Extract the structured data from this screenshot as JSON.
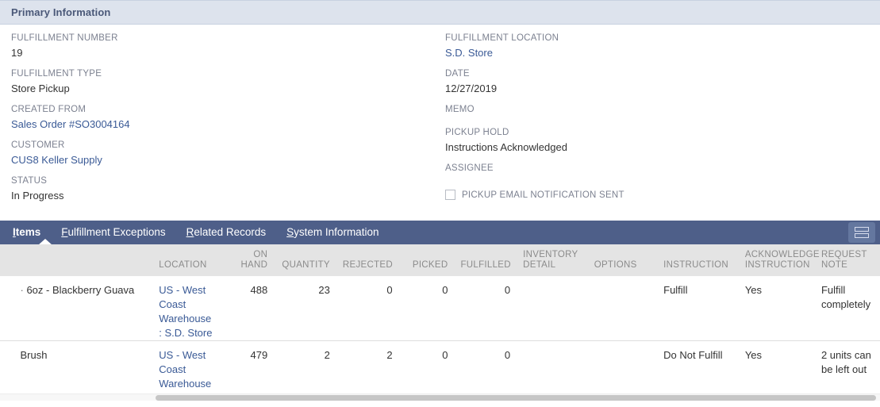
{
  "section": {
    "title": "Primary Information"
  },
  "primary": {
    "left_fields": [
      {
        "label": "FULFILLMENT NUMBER",
        "value": "19",
        "link": false
      },
      {
        "label": "FULFILLMENT TYPE",
        "value": "Store Pickup",
        "link": false
      },
      {
        "label": "CREATED FROM",
        "value": "Sales Order #SO3004164",
        "link": true
      },
      {
        "label": "CUSTOMER",
        "value": "CUS8 Keller Supply",
        "link": true
      },
      {
        "label": "STATUS",
        "value": "In Progress",
        "link": false
      }
    ],
    "right_fields": [
      {
        "label": "FULFILLMENT LOCATION",
        "value": "S.D. Store",
        "link": true
      },
      {
        "label": "DATE",
        "value": "12/27/2019",
        "link": false
      },
      {
        "label": "MEMO",
        "value": "",
        "link": false
      },
      {
        "label": "PICKUP HOLD",
        "value": "Instructions Acknowledged",
        "link": false
      },
      {
        "label": "ASSIGNEE",
        "value": "",
        "link": false
      }
    ],
    "checkbox": {
      "label": "PICKUP EMAIL NOTIFICATION SENT",
      "checked": false
    }
  },
  "tabs": [
    {
      "label": "Items",
      "accel": "I",
      "rest": "tems",
      "active": true
    },
    {
      "label": "Fulfillment Exceptions",
      "accel": "F",
      "rest": "ulfillment Exceptions",
      "active": false
    },
    {
      "label": "Related Records",
      "accel": "R",
      "rest": "elated Records",
      "active": false
    },
    {
      "label": "System Information",
      "accel": "S",
      "rest": "ystem Information",
      "active": false
    }
  ],
  "tab_menu_icon": "list-view-icon",
  "table": {
    "columns": [
      "LOCATION",
      "ON HAND",
      "QUANTITY",
      "REJECTED",
      "PICKED",
      "FULFILLED",
      "INVENTORY DETAIL",
      "OPTIONS",
      "INSTRUCTION",
      "ACKNOWLEDGE INSTRUCTION",
      "REQUEST NOTE"
    ],
    "columns_split": {
      "location": "LOCATION",
      "on_hand_l1": "ON",
      "on_hand_l2": "HAND",
      "quantity": "QUANTITY",
      "rejected": "REJECTED",
      "picked": "PICKED",
      "fulfilled": "FULFILLED",
      "inventory_l1": "INVENTORY",
      "inventory_l2": "DETAIL",
      "options": "OPTIONS",
      "instruction": "INSTRUCTION",
      "acknowledge_l1": "ACKNOWLEDGE",
      "acknowledge_l2": "INSTRUCTION",
      "request_l1": "REQUEST",
      "request_l2": "NOTE"
    },
    "rows": [
      {
        "item_prefix": "·",
        "item": "6oz - Blackberry Guava",
        "location": "US - West Coast Warehouse : S.D. Store",
        "on_hand": "488",
        "quantity": "23",
        "rejected": "0",
        "picked": "0",
        "fulfilled": "0",
        "inventory_detail": "",
        "options": "",
        "instruction": "Fulfill",
        "acknowledge_instruction": "Yes",
        "request_note": "Fulfill completely"
      },
      {
        "item_prefix": "",
        "item": "Brush",
        "location": "US - West Coast Warehouse : S.D. Store",
        "on_hand": "479",
        "quantity": "2",
        "rejected": "2",
        "picked": "0",
        "fulfilled": "0",
        "inventory_detail": "",
        "options": "",
        "instruction": "Do Not Fulfill",
        "acknowledge_instruction": "Yes",
        "request_note": "2 units can be left out"
      }
    ]
  },
  "colors": {
    "header_bg": "#dde3ed",
    "header_text": "#4a5878",
    "tabbar_bg": "#4e5f89",
    "link": "#3a5a96",
    "table_header_bg": "#e4e4e4",
    "table_header_text": "#8b8b8b"
  }
}
